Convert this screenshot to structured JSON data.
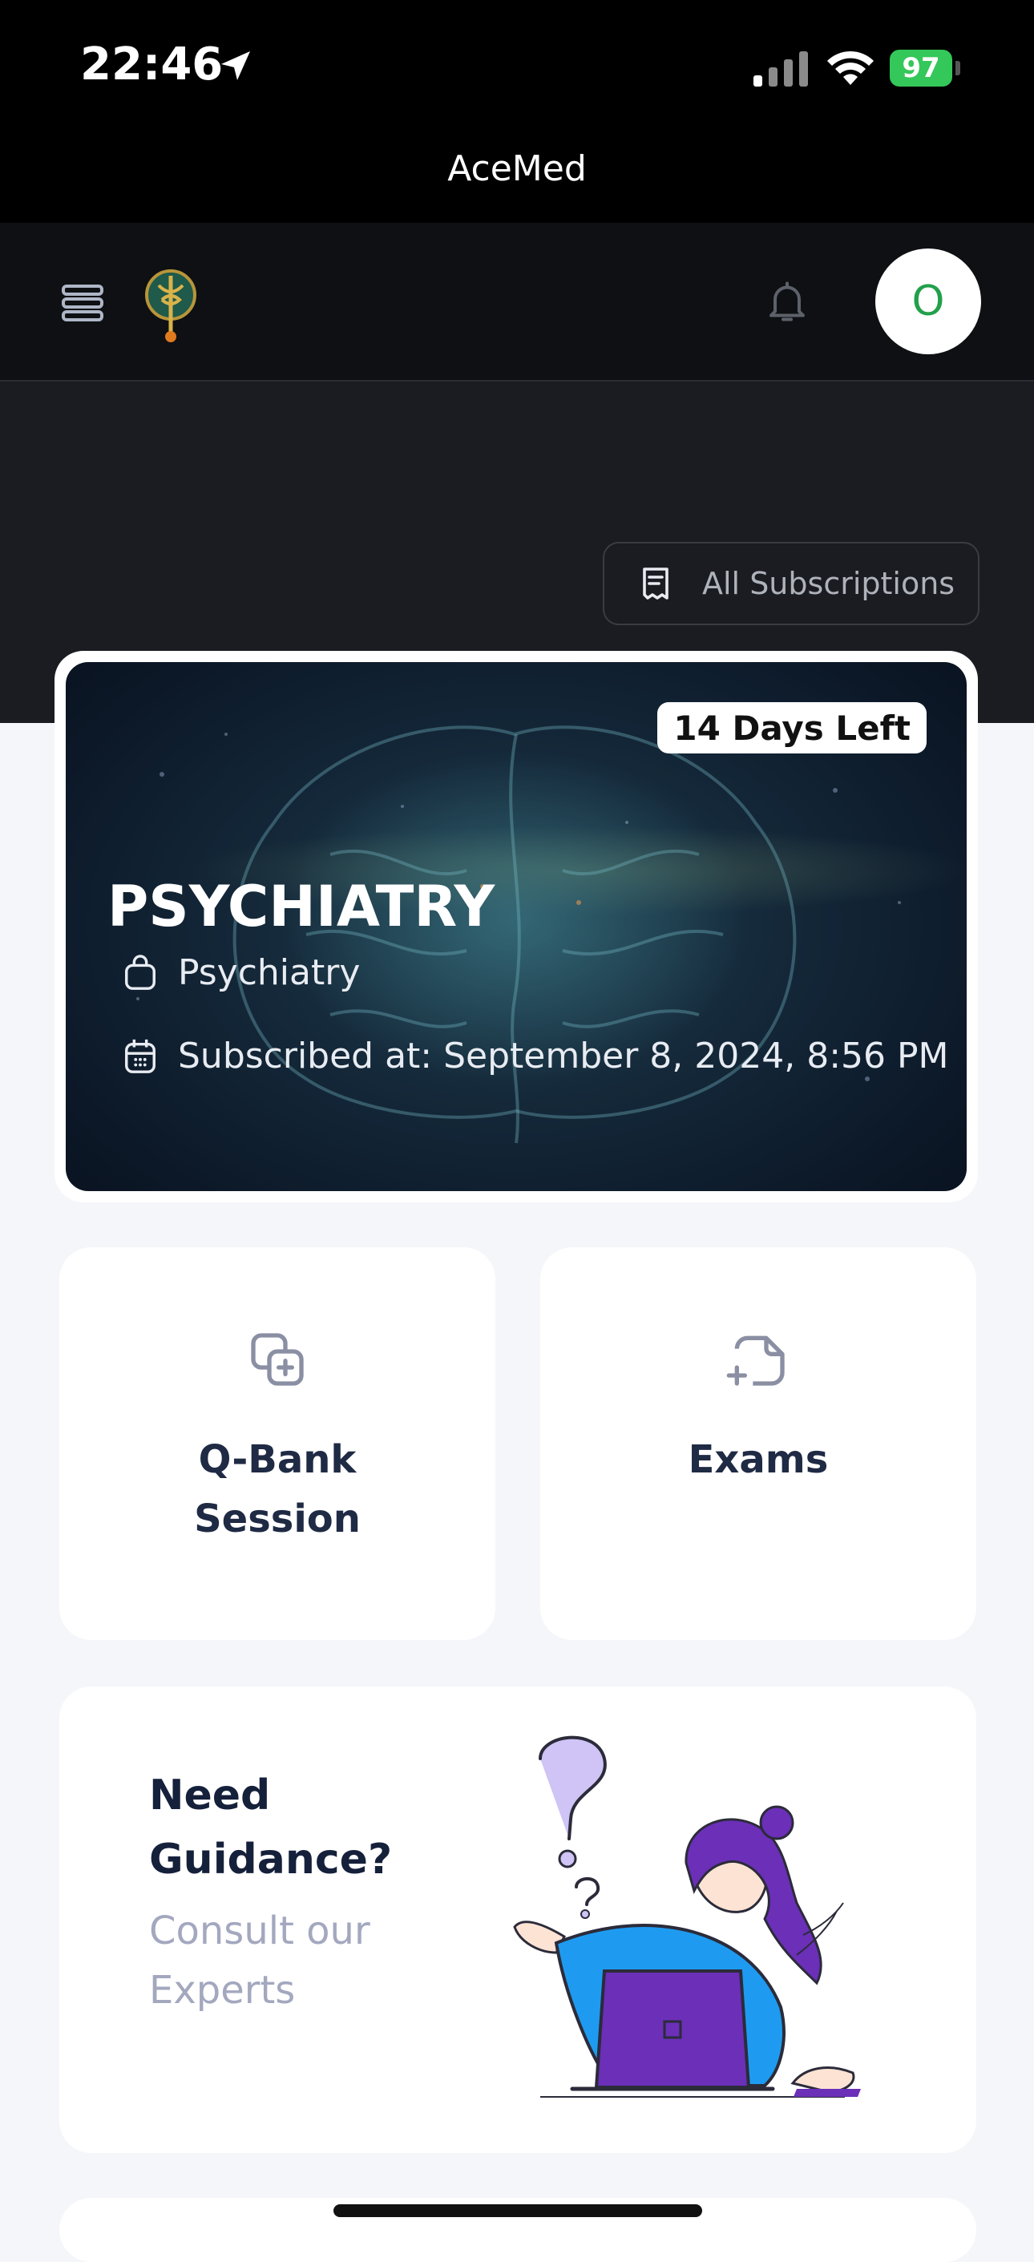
{
  "status_bar": {
    "time": "22:46",
    "battery": "97"
  },
  "app": {
    "title": "AceMed"
  },
  "header": {
    "avatar_initial": "O",
    "subscriptions_button": "All Subscriptions"
  },
  "course_card": {
    "days_left": "14 Days Left",
    "title": "PSYCHIATRY",
    "category": "Psychiatry",
    "subscribed_at": "Subscribed at: September 8, 2024, 8:56 PM"
  },
  "tiles": {
    "qbank_line1": "Q-Bank",
    "qbank_line2": "Session",
    "exams": "Exams"
  },
  "guidance": {
    "title": "Need Guidance?",
    "subtitle": "Consult our Experts"
  },
  "colors": {
    "accent_green": "#34c759",
    "avatar_text": "#22a04b",
    "heading": "#1f2a44",
    "muted": "#a3a8bf",
    "illustration_purple": "#6b2fb8",
    "illustration_blue": "#1e9bf0"
  },
  "icons": {
    "location": "location-arrow-icon",
    "signal": "cellular-signal-icon",
    "wifi": "wifi-icon",
    "menu": "menu-stack-icon",
    "logo": "caduceus-logo-icon",
    "notifications": "bell-icon",
    "subscriptions": "receipt-icon",
    "category": "bag-icon",
    "calendar": "calendar-icon",
    "qbank": "copy-plus-icon",
    "exams": "file-plus-icon"
  }
}
